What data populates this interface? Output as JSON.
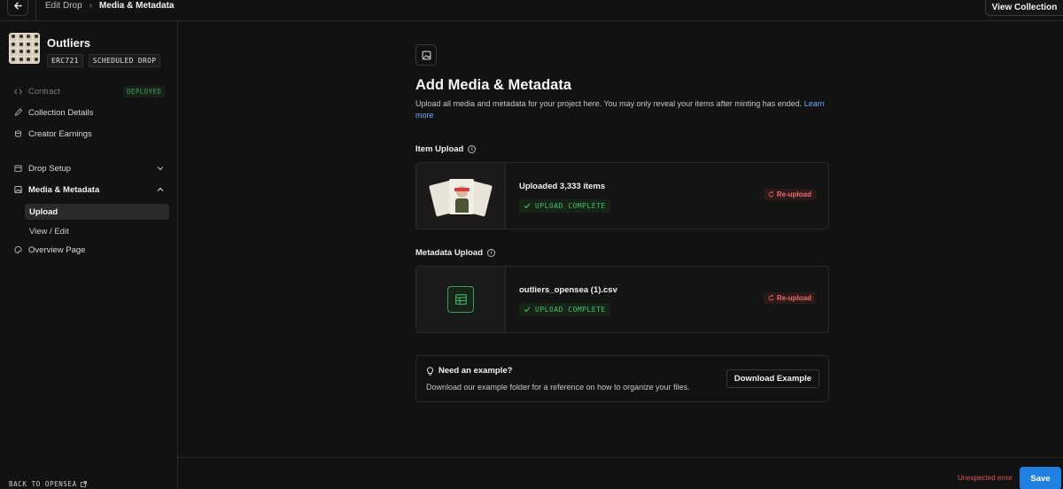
{
  "topbar": {
    "breadcrumb": [
      "Edit Drop",
      "Media & Metadata"
    ],
    "view_collection": "View Collection"
  },
  "sidebar": {
    "collection_name": "Outliers",
    "tags": [
      "ERC721",
      "SCHEDULED DROP"
    ],
    "items": [
      {
        "label": "Contract",
        "icon": "code-icon",
        "badge": "DEPLOYED"
      },
      {
        "label": "Collection Details",
        "icon": "pencil-icon"
      },
      {
        "label": "Creator Earnings",
        "icon": "coins-icon"
      },
      {
        "label": "Drop Setup",
        "icon": "calendar-icon"
      },
      {
        "label": "Media & Metadata",
        "icon": "image-icon"
      },
      {
        "label": "Overview Page",
        "icon": "palette-icon"
      }
    ],
    "sub_items": [
      "Upload",
      "View / Edit"
    ],
    "back_link": "BACK TO OPENSEA"
  },
  "main": {
    "title": "Add Media & Metadata",
    "description": "Upload all media and metadata for your project here. You may only reveal your items after minting has ended.",
    "learn_more": "Learn more",
    "item_upload": {
      "label": "Item Upload",
      "title": "Uploaded 3,333 items",
      "status": "UPLOAD COMPLETE",
      "action": "Re-upload"
    },
    "metadata_upload": {
      "label": "Metadata Upload",
      "title": "outliers_opensea (1).csv",
      "status": "UPLOAD COMPLETE",
      "action": "Re-upload"
    },
    "example": {
      "title": "Need an example?",
      "description": "Download our example folder for a reference on how to organize your files.",
      "button": "Download Example"
    }
  },
  "footer": {
    "error": "Unexpected error",
    "save": "Save"
  },
  "colors": {
    "accent": "#2081e2",
    "success": "#46c26c",
    "danger": "#f06b6b",
    "link": "#6ea8fe"
  }
}
